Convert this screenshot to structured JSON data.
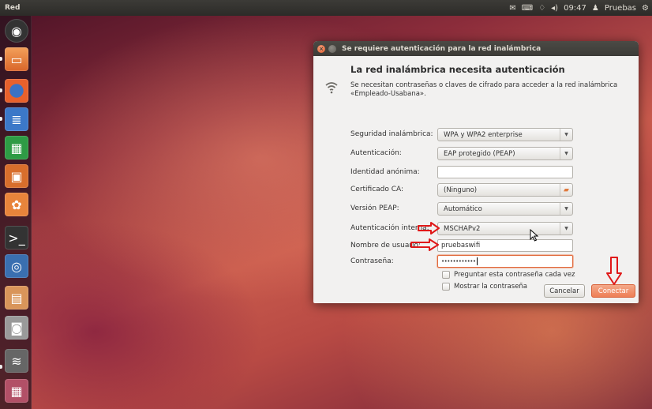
{
  "top_panel": {
    "title": "Red",
    "clock": "09:47",
    "user": "Pruebas",
    "indicator_icons": [
      "mail-icon",
      "keyboard-icon",
      "network-icon",
      "volume-icon",
      "user-icon",
      "gear-icon"
    ]
  },
  "launcher": {
    "items": [
      {
        "name": "dash-home-icon",
        "color": "#3a3a3a"
      },
      {
        "name": "files-icon",
        "color": "#e8843b"
      },
      {
        "name": "firefox-icon",
        "color": "#e8612c"
      },
      {
        "name": "libreoffice-writer-icon",
        "color": "#3c78c8"
      },
      {
        "name": "libreoffice-calc-icon",
        "color": "#2e9b45"
      },
      {
        "name": "libreoffice-impress-icon",
        "color": "#d86e2c"
      },
      {
        "name": "software-center-icon",
        "color": "#e8843b"
      },
      {
        "name": "terminal-icon",
        "color": "#333333"
      },
      {
        "name": "thunderbird-icon",
        "color": "#3a6fb0"
      },
      {
        "name": "archive-icon",
        "color": "#d9955a"
      },
      {
        "name": "screenshot-icon",
        "color": "#9a9a9a"
      },
      {
        "name": "wireless-icon",
        "color": "#666666"
      },
      {
        "name": "workspace-switcher-icon",
        "color": "#b25067"
      },
      {
        "name": "trash-icon",
        "color": "#555555"
      }
    ]
  },
  "dialog": {
    "title": "Se requiere autenticación para la red inalámbrica",
    "heading": "La red inalámbrica necesita autenticación",
    "description": "Se necesitan contraseñas o claves de cifrado para acceder a la red inalámbrica «Empleado-Usabana».",
    "fields": {
      "security_label": "Seguridad inalámbrica:",
      "security_value": "WPA y WPA2 enterprise",
      "auth_label": "Autenticación:",
      "auth_value": "EAP protegido (PEAP)",
      "anon_label": "Identidad anónima:",
      "anon_value": "",
      "ca_label": "Certificado CA:",
      "ca_value": "(Ninguno)",
      "peap_label": "Versión PEAP:",
      "peap_value": "Automático",
      "inner_label": "Autenticación interna:",
      "inner_value": "MSCHAPv2",
      "user_label": "Nombre de usuario:",
      "user_value": "pruebaswifi",
      "pass_label": "Contraseña:",
      "pass_value": "••••••••••••"
    },
    "checkboxes": {
      "ask_always": "Preguntar esta contraseña cada vez",
      "show_password": "Mostrar la contraseña"
    },
    "buttons": {
      "cancel": "Cancelar",
      "connect": "Conectar"
    }
  },
  "colors": {
    "accent": "#ee7e55",
    "annotation_red": "#e01818",
    "panel": "#3c3b37"
  }
}
